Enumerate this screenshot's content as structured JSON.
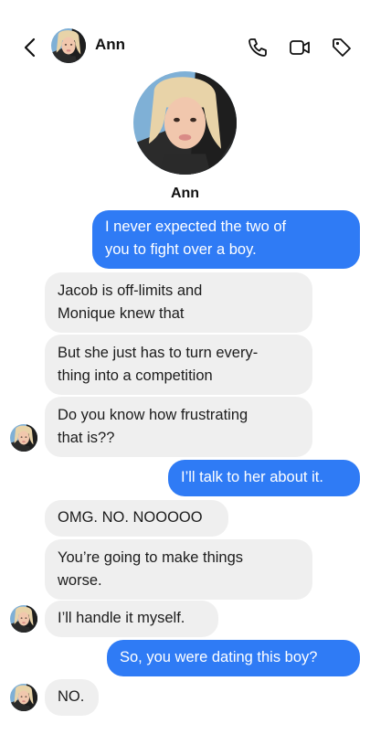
{
  "header": {
    "contact_name": "Ann",
    "icons": [
      "back-chevron-icon",
      "phone-icon",
      "video-camera-icon",
      "tag-icon"
    ]
  },
  "profile": {
    "name": "Ann"
  },
  "messages": [
    {
      "direction": "outgoing",
      "lines": [
        "I never expected the two of",
        "you to fight over a boy."
      ]
    },
    {
      "direction": "incoming",
      "lines": [
        "Jacob is off-limits and",
        "Monique knew that"
      ]
    },
    {
      "direction": "incoming",
      "lines": [
        "But she just has to turn every-",
        "thing into a competition"
      ]
    },
    {
      "direction": "incoming",
      "lines": [
        "Do you know how frustrating",
        "that is??"
      ]
    },
    {
      "direction": "outgoing",
      "lines": [
        "I’ll talk to her about it."
      ]
    },
    {
      "direction": "incoming",
      "lines": [
        "OMG. NO. NOOOOO"
      ]
    },
    {
      "direction": "incoming",
      "lines": [
        "You’re going to make things",
        "worse."
      ]
    },
    {
      "direction": "incoming",
      "lines": [
        "I’ll handle it myself."
      ]
    },
    {
      "direction": "outgoing",
      "lines": [
        "So, you were dating this boy?"
      ]
    },
    {
      "direction": "incoming",
      "lines": [
        "NO."
      ]
    }
  ],
  "colors": {
    "outgoing_bubble": "#2f7bf5",
    "incoming_bubble": "#efefef"
  }
}
